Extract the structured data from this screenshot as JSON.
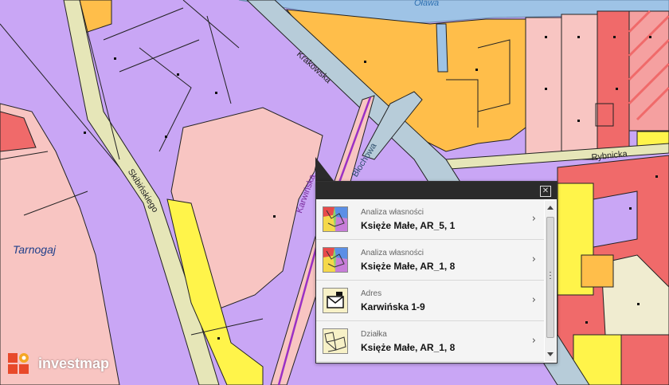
{
  "map": {
    "labels": {
      "river": "Oława",
      "krakowska": "Krakowska",
      "skibinskiego": "Skibińskiego",
      "tarnogaj": "Tarnogaj",
      "karwinska": "Karwińska",
      "blochowa": "Błochowa",
      "rybnicka": "Rybnicka"
    },
    "colors": {
      "residential_purple": "#c9a6f5",
      "commercial_orange": "#ffbe4a",
      "pink": "#f8c5c2",
      "red": "#f06a6a",
      "yellow": "#fff44a",
      "road": "#b7ccd9",
      "path_beige": "#e6e6b8",
      "water": "#9ec3e6",
      "cream": "#f0ecd0"
    }
  },
  "popup": {
    "close_label": "✕",
    "items": [
      {
        "category": "Analiza własności",
        "value": "Księże Małe, AR_5, 1",
        "icon": "ownership-map-icon"
      },
      {
        "category": "Analiza własności",
        "value": "Księże Małe, AR_1, 8",
        "icon": "ownership-map-icon"
      },
      {
        "category": "Adres",
        "value": "Karwińska 1-9",
        "icon": "address-envelope-icon"
      },
      {
        "category": "Działka",
        "value": "Księże Małe, AR_1, 8",
        "icon": "parcel-map-icon"
      }
    ],
    "chevron": "›"
  },
  "brand": {
    "name": "investmap"
  }
}
